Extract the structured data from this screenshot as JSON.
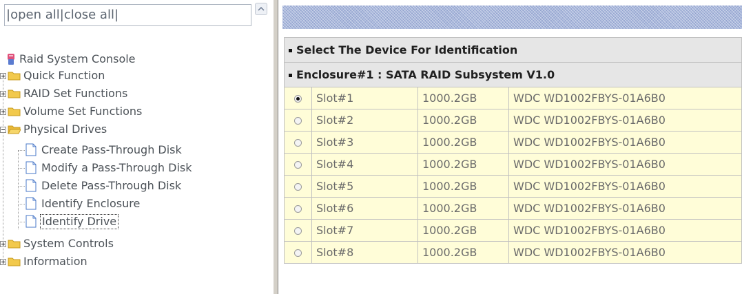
{
  "topbar": {
    "sep_left": "|",
    "open_all": "open all",
    "sep_mid": "|",
    "close_all": "close all",
    "sep_right": "|"
  },
  "tree": {
    "root": "Raid System Console",
    "items": [
      {
        "label": "Quick Function",
        "expanded": false
      },
      {
        "label": "RAID Set Functions",
        "expanded": false
      },
      {
        "label": "Volume Set Functions",
        "expanded": false
      },
      {
        "label": "Physical Drives",
        "expanded": true
      },
      {
        "label": "System Controls",
        "expanded": false
      },
      {
        "label": "Information",
        "expanded": false
      }
    ],
    "physical_children": [
      "Create Pass-Through Disk",
      "Modify a Pass-Through Disk",
      "Delete Pass-Through Disk",
      "Identify Enclosure",
      "Identify Drive"
    ],
    "selected": "Identify Drive"
  },
  "main": {
    "header1": "Select The Device For Identification",
    "header2": "Enclosure#1 : SATA RAID Subsystem V1.0",
    "rows": [
      {
        "slot": "Slot#1",
        "capacity": "1000.2GB",
        "model": "WDC WD1002FBYS-01A6B0",
        "selected": true
      },
      {
        "slot": "Slot#2",
        "capacity": "1000.2GB",
        "model": "WDC WD1002FBYS-01A6B0",
        "selected": false
      },
      {
        "slot": "Slot#3",
        "capacity": "1000.2GB",
        "model": "WDC WD1002FBYS-01A6B0",
        "selected": false
      },
      {
        "slot": "Slot#4",
        "capacity": "1000.2GB",
        "model": "WDC WD1002FBYS-01A6B0",
        "selected": false
      },
      {
        "slot": "Slot#5",
        "capacity": "1000.2GB",
        "model": "WDC WD1002FBYS-01A6B0",
        "selected": false
      },
      {
        "slot": "Slot#6",
        "capacity": "1000.2GB",
        "model": "WDC WD1002FBYS-01A6B0",
        "selected": false
      },
      {
        "slot": "Slot#7",
        "capacity": "1000.2GB",
        "model": "WDC WD1002FBYS-01A6B0",
        "selected": false
      },
      {
        "slot": "Slot#8",
        "capacity": "1000.2GB",
        "model": "WDC WD1002FBYS-01A6B0",
        "selected": false
      }
    ]
  },
  "colors": {
    "row_bg": "#fffdd8",
    "header_bg": "#e6e6e6",
    "folder": "#f2c94c",
    "bluebar": "#a9b8dc"
  },
  "icons": [
    "raid-console-icon",
    "folder-icon",
    "open-folder-icon",
    "page-icon",
    "expand-plus-icon",
    "collapse-minus-icon",
    "radio-button-icon",
    "scroll-up-icon"
  ]
}
